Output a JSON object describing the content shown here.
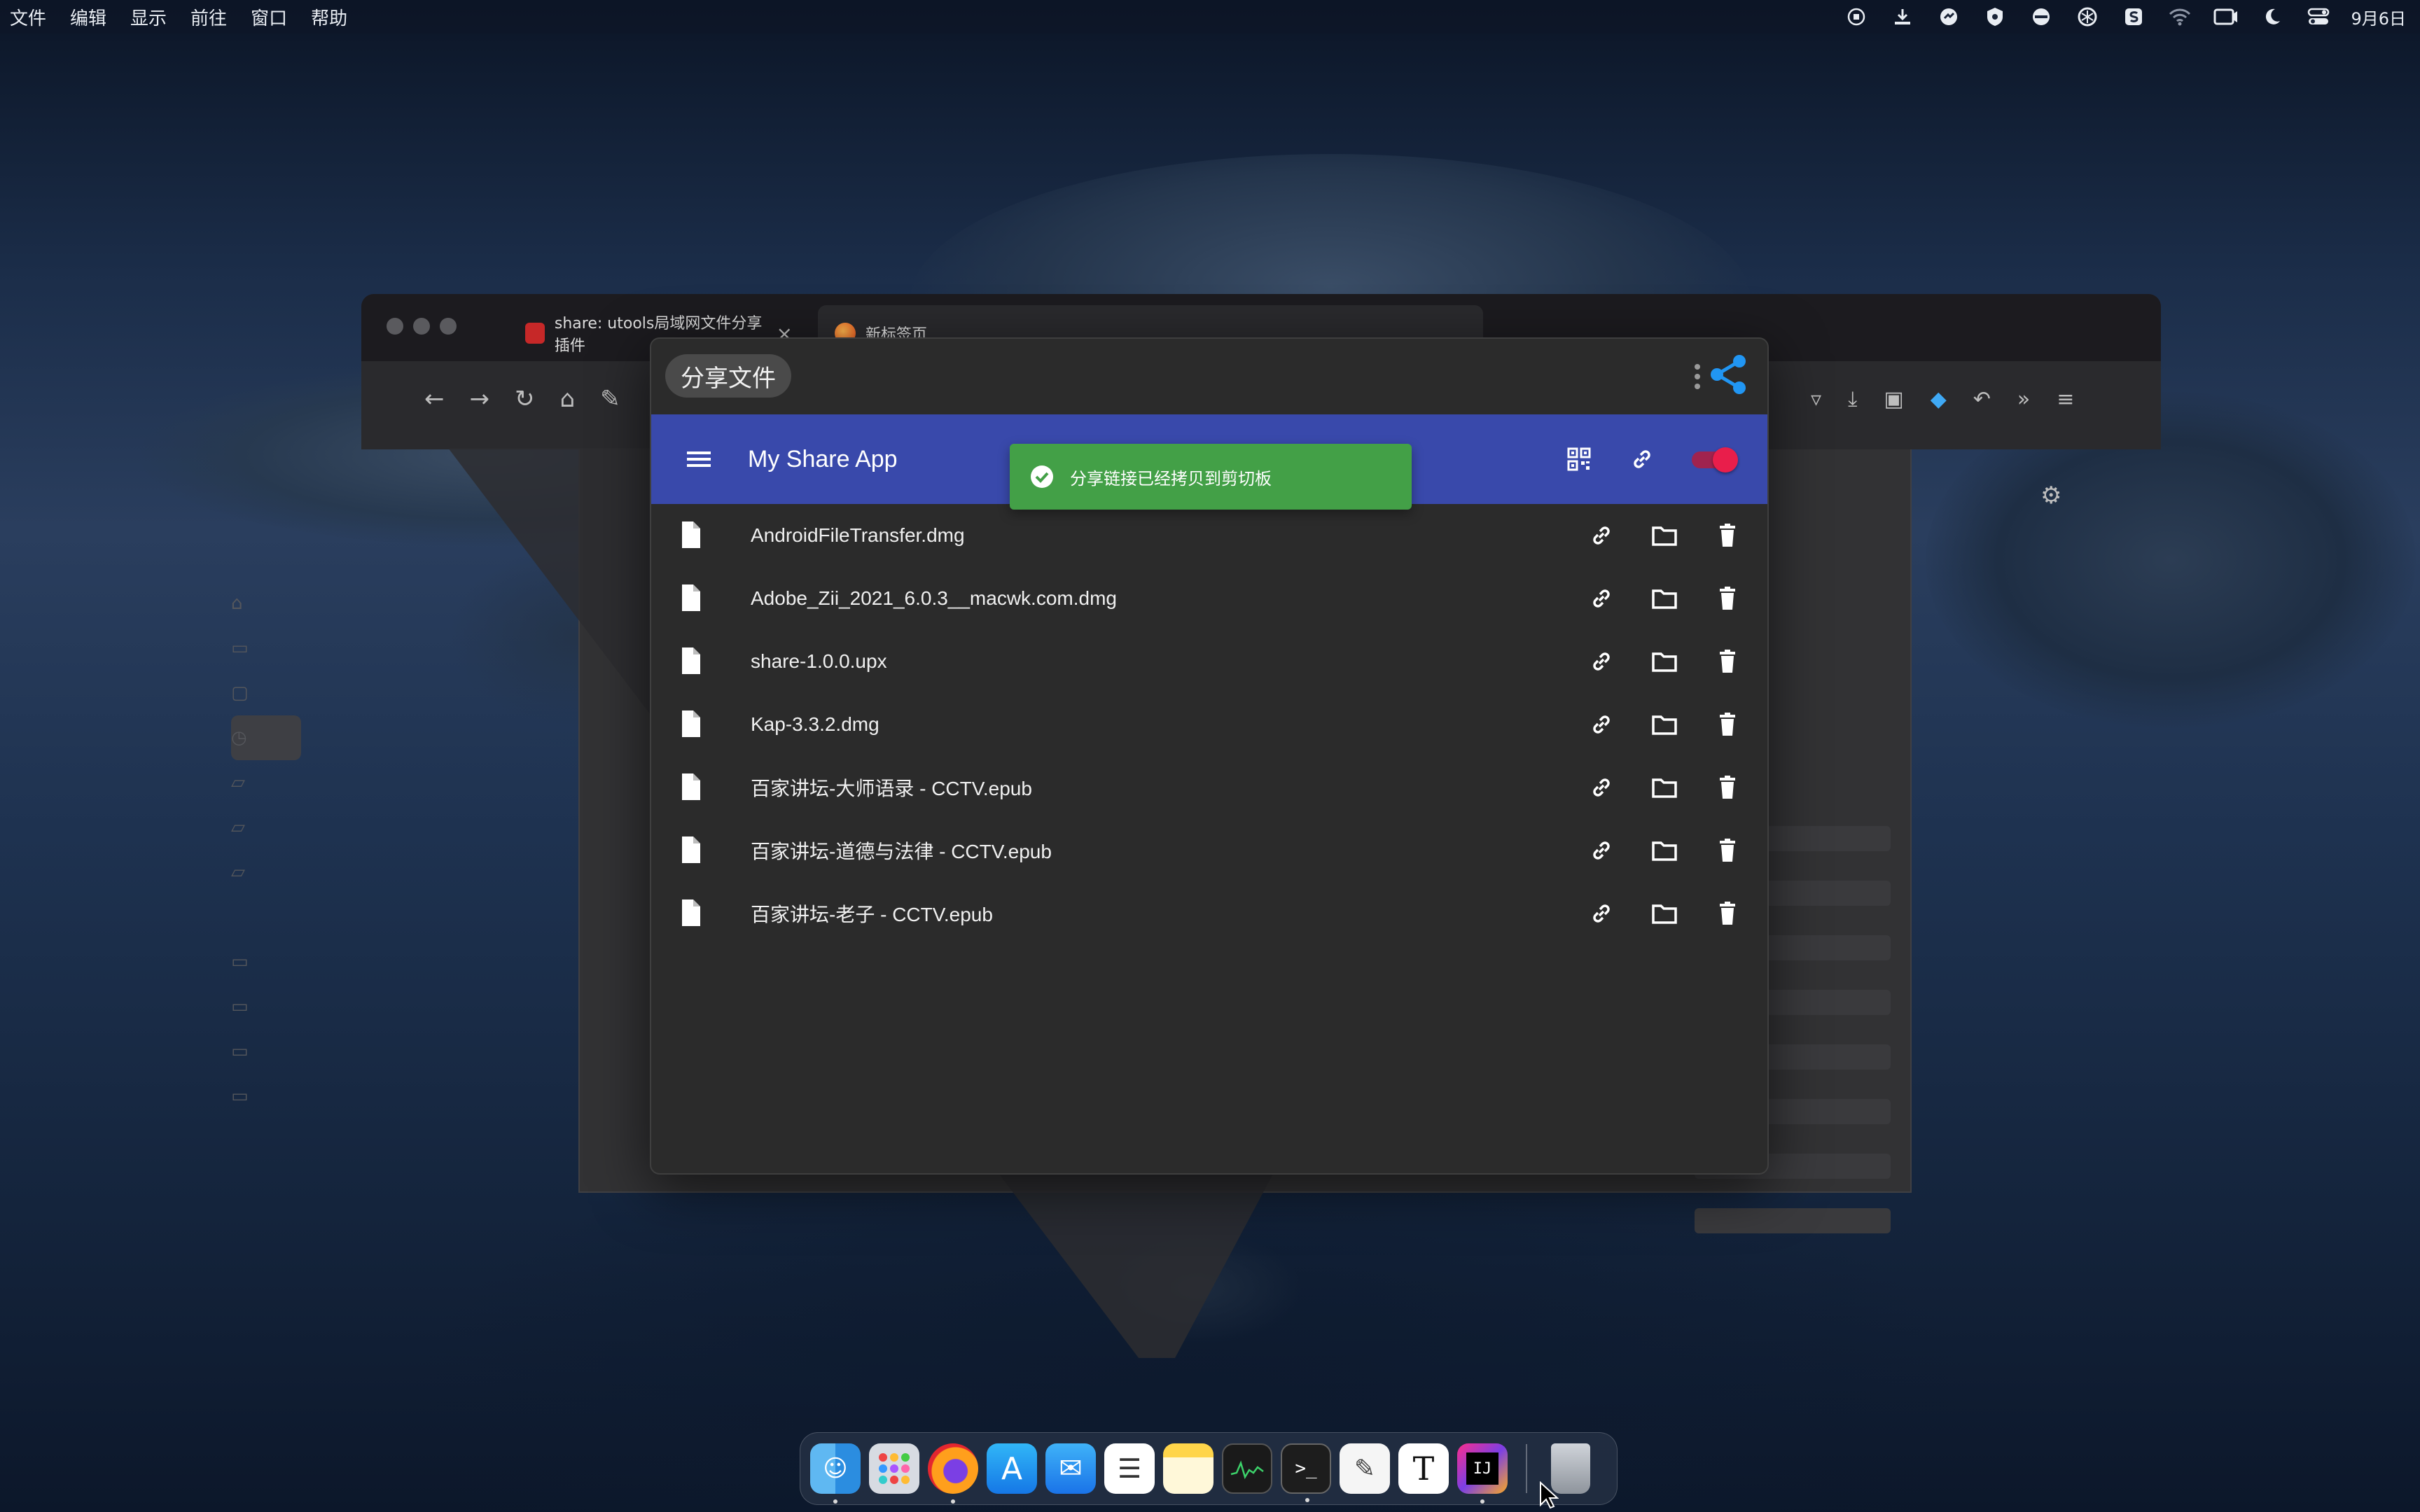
{
  "menubar": {
    "items": [
      "文件",
      "编辑",
      "显示",
      "前往",
      "窗口",
      "帮助"
    ],
    "date": "9月6日"
  },
  "browser": {
    "tabs": [
      {
        "title": "share: utools局域网文件分享插件"
      },
      {
        "title": "新标签页"
      }
    ]
  },
  "app_window": {
    "title": "分享文件",
    "appbar_title": "My Share App",
    "toast_message": "分享链接已经拷贝到剪切板",
    "share_toggle_on": true,
    "accent_color": "#3949ab",
    "toast_color": "#43a047",
    "toggle_color": "#e91e4b",
    "files": [
      {
        "name": "AndroidFileTransfer.dmg"
      },
      {
        "name": "Adobe_Zii_2021_6.0.3__macwk.com.dmg"
      },
      {
        "name": "share-1.0.0.upx"
      },
      {
        "name": "Kap-3.3.2.dmg"
      },
      {
        "name": "百家讲坛-大师语录 - CCTV.epub"
      },
      {
        "name": "百家讲坛-道德与法律 - CCTV.epub"
      },
      {
        "name": "百家讲坛-老子 - CCTV.epub"
      }
    ]
  },
  "dock": {
    "apps": [
      "finder",
      "launchpad",
      "firefox",
      "app-store",
      "mail",
      "reminders",
      "notes",
      "activity-monitor",
      "terminal",
      "textedit",
      "typora",
      "intellij-idea",
      "trash"
    ]
  }
}
